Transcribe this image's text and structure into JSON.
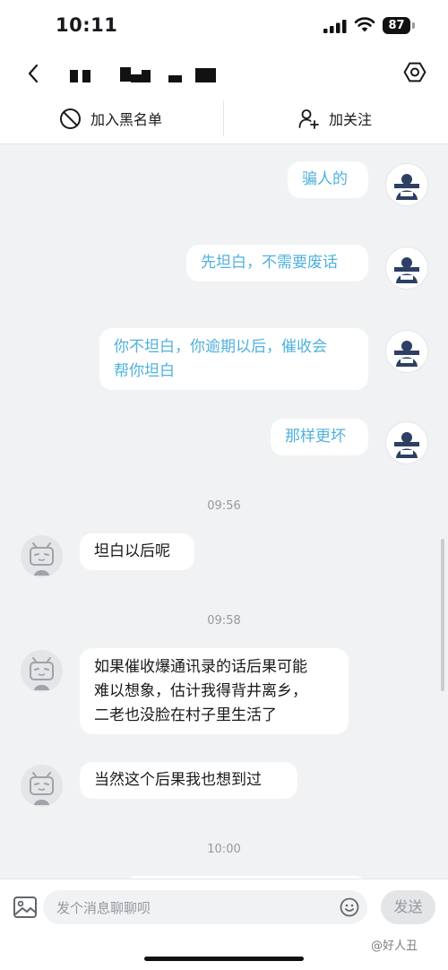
{
  "status": {
    "time": "10:11",
    "battery": "87"
  },
  "header": {
    "contact_name_redacted": true
  },
  "actions": {
    "block_label": "加入黑名单",
    "follow_label": "加关注"
  },
  "messages": [
    {
      "from": "me",
      "text": "骗人的"
    },
    {
      "from": "me",
      "text": "先坦白，不需要废话"
    },
    {
      "from": "me",
      "lines": [
        "你不坦白，你逾期以后，催收会",
        "帮你坦白"
      ]
    },
    {
      "from": "me",
      "text": "那样更坏"
    },
    {
      "type": "time",
      "text": "09:56"
    },
    {
      "from": "them",
      "text": "坦白以后呢"
    },
    {
      "type": "time",
      "text": "09:58"
    },
    {
      "from": "them",
      "lines": [
        "如果催收爆通讯录的话后果可能",
        "难以想象，估计我得背井离乡，",
        "二老也没脸在村子里生活了"
      ]
    },
    {
      "from": "them",
      "text": "当然这个后果我也想到过"
    },
    {
      "type": "time",
      "text": "10:00"
    }
  ],
  "input": {
    "placeholder": "发个消息聊聊呗",
    "send_label": "发送"
  },
  "watermark": "@好人丑",
  "colors": {
    "my_text": "#4fb1dd",
    "chat_bg": "#f1f2f3"
  }
}
